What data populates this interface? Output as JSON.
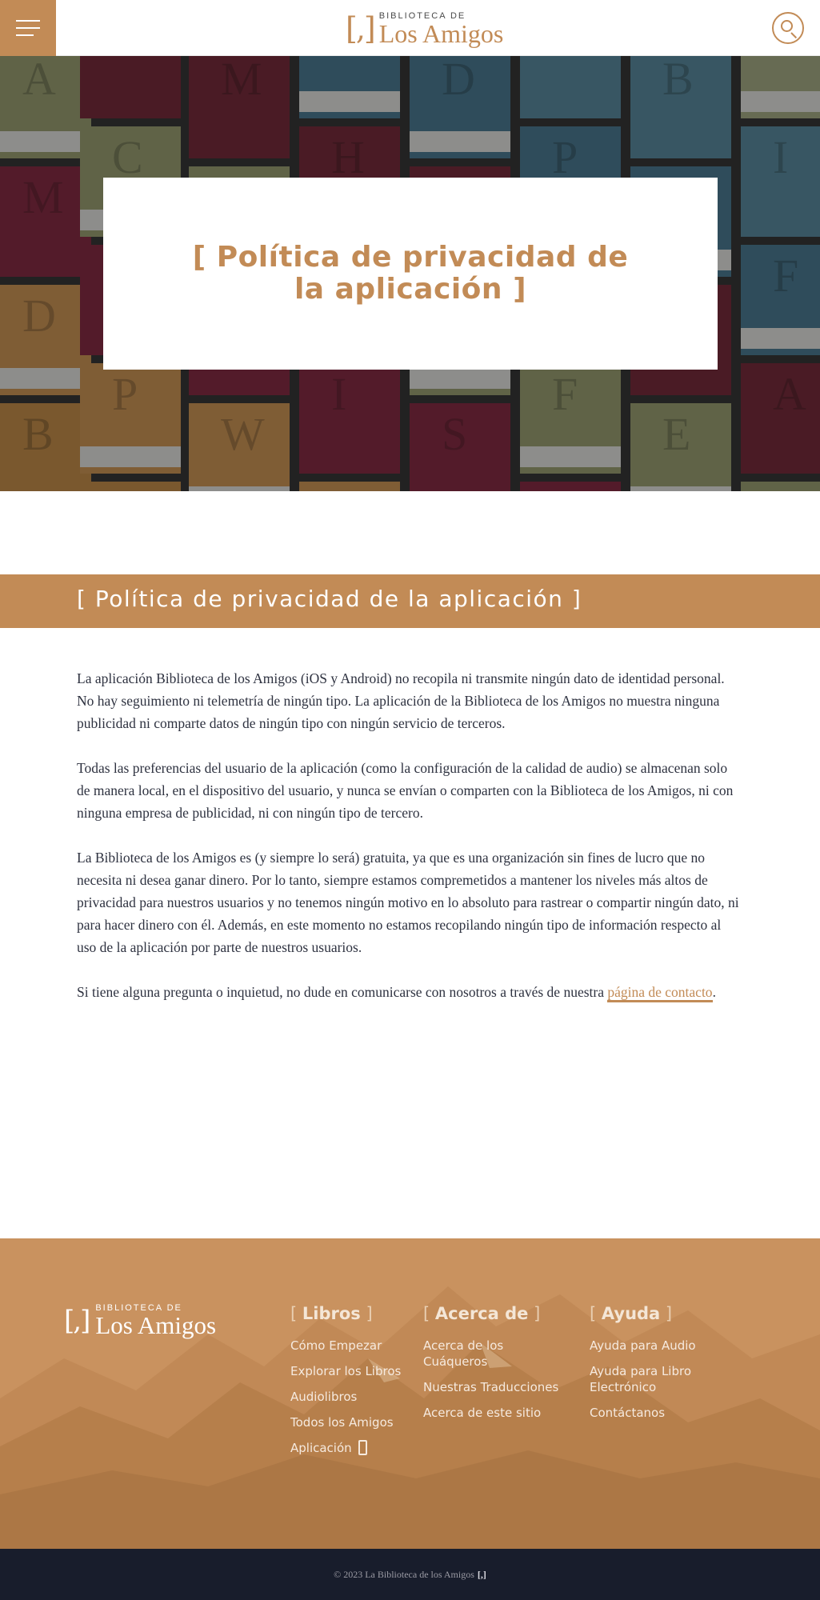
{
  "header": {
    "logo_small": "BIBLIOTECA DE",
    "logo_big": "Los Amigos",
    "logo_bracket": "[,]"
  },
  "hero": {
    "title": "[ Política de privacidad de la aplicación ]"
  },
  "page": {
    "title": "[ Política de privacidad de la aplicación ]",
    "paragraphs": [
      "La aplicación Biblioteca de los Amigos (iOS y Android) no recopila ni transmite ningún dato de identidad personal. No hay seguimiento ni telemetría de ningún tipo. La aplicación de la Biblioteca de los Amigos no muestra ninguna publicidad ni comparte datos de ningún tipo con ningún servicio de terceros.",
      "Todas las preferencias del usuario de la aplicación (como la configuración de la calidad de audio) se almacenan solo de manera local, en el dispositivo del usuario, y nunca se envían o comparten con la Biblioteca de los Amigos, ni con ninguna empresa de publicidad, ni con ningún tipo de tercero.",
      "La Biblioteca de los Amigos es (y siempre lo será) gratuita, ya que es una organización sin fines de lucro que no necesita ni desea ganar dinero. Por lo tanto, siempre estamos compremetidos a mantener los niveles más altos de privacidad para nuestros usuarios y no tenemos ningún motivo en lo absoluto para rastrear o compartir ningún dato, ni para hacer dinero con él. Además, en este momento no estamos recopilando ningún tipo de información respecto al uso de la aplicación por parte de nuestros usuarios."
    ],
    "contact_prefix": "Si tiene alguna pregunta o inquietud, no dude en comunicarse con nosotros a través de nuestra ",
    "contact_link": "página de contacto",
    "contact_suffix": "."
  },
  "footer": {
    "logo_small": "BIBLIOTECA DE",
    "logo_big": "Los Amigos",
    "logo_bracket": "[,]",
    "columns": [
      {
        "heading": "Libros",
        "links": [
          "Cómo Empezar",
          "Explorar los Libros",
          "Audiolibros",
          "Todos los Amigos",
          "Aplicación"
        ]
      },
      {
        "heading": "Acerca de",
        "links": [
          "Acerca de los Cuáqueros",
          "Nuestras Traducciones",
          "Acerca de este sitio"
        ]
      },
      {
        "heading": "Ayuda",
        "links": [
          "Ayuda para Audio",
          "Ayuda para Libro Electrónico",
          "Contáctanos"
        ]
      }
    ],
    "copyright": "© 2023 La Biblioteca de los Amigos",
    "copyright_mark": "[,]"
  },
  "icons": {
    "menu": "hamburger-menu-icon",
    "search": "search-icon",
    "app": "phone-icon"
  },
  "colors": {
    "accent": "#c28b56",
    "footer_bg": "#c9925f",
    "bottom_bar": "#181d2c",
    "text": "#2e3240"
  }
}
